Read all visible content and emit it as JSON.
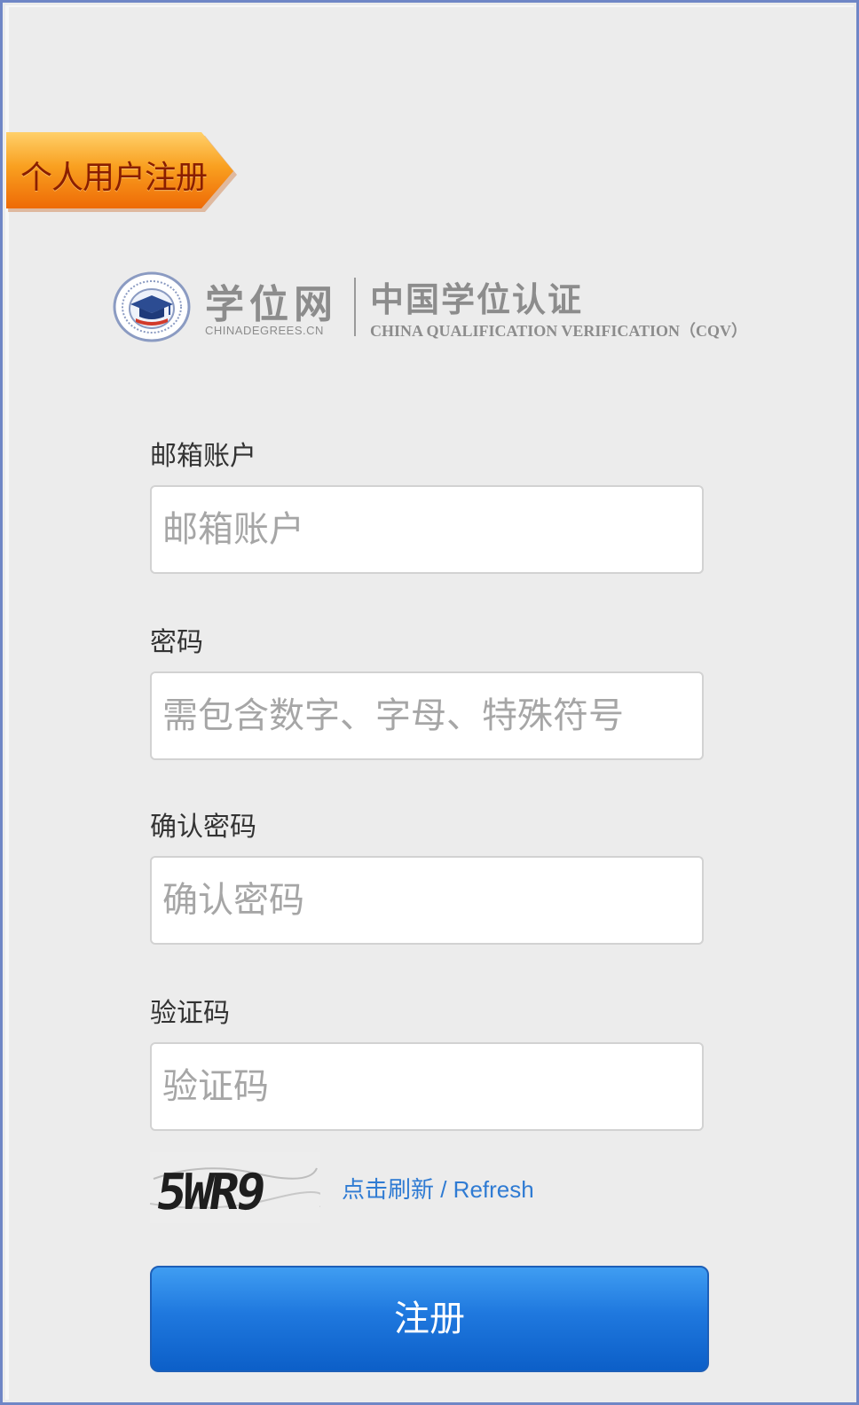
{
  "ribbon": {
    "label": "个人用户注册"
  },
  "logo": {
    "cn_name": "学位网",
    "domain": "CHINADEGREES.CN",
    "title": "中国学位认证",
    "subtitle": "CHINA QUALIFICATION VERIFICATION（CQV）"
  },
  "form": {
    "email": {
      "label": "邮箱账户",
      "placeholder": "邮箱账户"
    },
    "password": {
      "label": "密码",
      "placeholder": "需包含数字、字母、特殊符号"
    },
    "confirm": {
      "label": "确认密码",
      "placeholder": "确认密码"
    },
    "captcha": {
      "label": "验证码",
      "placeholder": "验证码",
      "image_text": "5WR9"
    },
    "refresh_label": "点击刷新 / Refresh",
    "submit_label": "注册"
  },
  "colors": {
    "ribbon_orange": "#f7941d",
    "link_blue": "#2f7bd3",
    "button_blue": "#1f78de",
    "frame_border": "#6f86c6"
  }
}
